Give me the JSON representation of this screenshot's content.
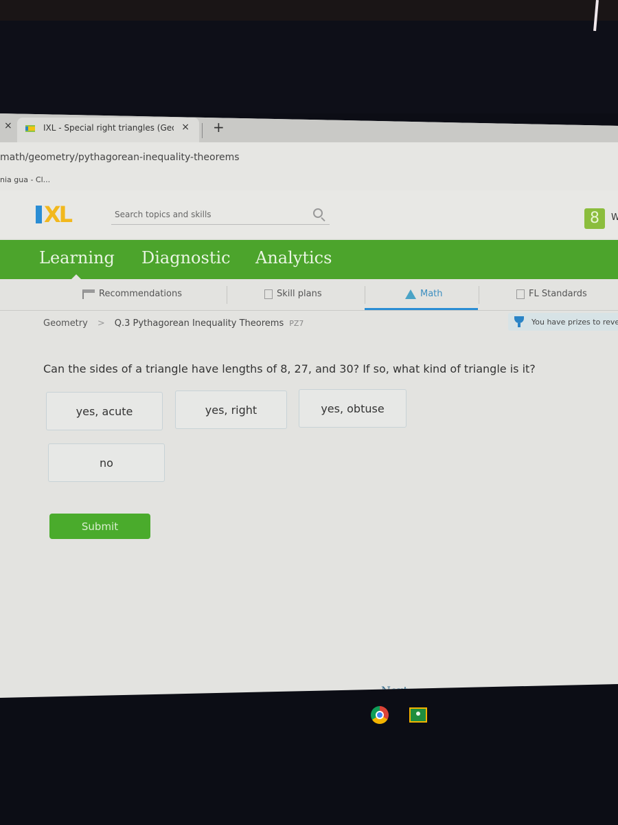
{
  "browser": {
    "tab_title": "IXL - Special right triangles (Geo",
    "tab_close": "×",
    "new_tab": "+",
    "left_close": "×",
    "url": "math/geometry/pythagorean-inequality-theorems",
    "bookmark": "nia gua - Cl..."
  },
  "header": {
    "logo_text": "XL",
    "search_placeholder": "Search topics and skills",
    "user_initial": "8",
    "user_name_partial": "W"
  },
  "main_nav": [
    {
      "label": "Learning",
      "active": true
    },
    {
      "label": "Diagnostic",
      "active": false
    },
    {
      "label": "Analytics",
      "active": false
    }
  ],
  "sub_nav": [
    {
      "label": "Recommendations",
      "icon": "signpost-icon"
    },
    {
      "label": "Skill plans",
      "icon": "skill-plan-icon"
    },
    {
      "label": "Math",
      "icon": "pyramid-icon",
      "active": true
    },
    {
      "label": "FL Standards",
      "icon": "clipboard-icon"
    }
  ],
  "breadcrumb": {
    "subject": "Geometry",
    "separator": ">",
    "skill": "Q.3 Pythagorean Inequality Theorems",
    "code": "PZ7"
  },
  "prizes_banner": "You have prizes to reve",
  "question": "Can the sides of a triangle have lengths of 8, 27, and 30? If so, what kind of triangle is it?",
  "choices": [
    "yes, acute",
    "yes, right",
    "yes, obtuse",
    "no"
  ],
  "submit_label": "Submit",
  "next_up": "Next up",
  "colors": {
    "nav_green": "#4ca42c",
    "accent_blue": "#2a8dd4",
    "logo_yellow": "#f2b81d"
  }
}
